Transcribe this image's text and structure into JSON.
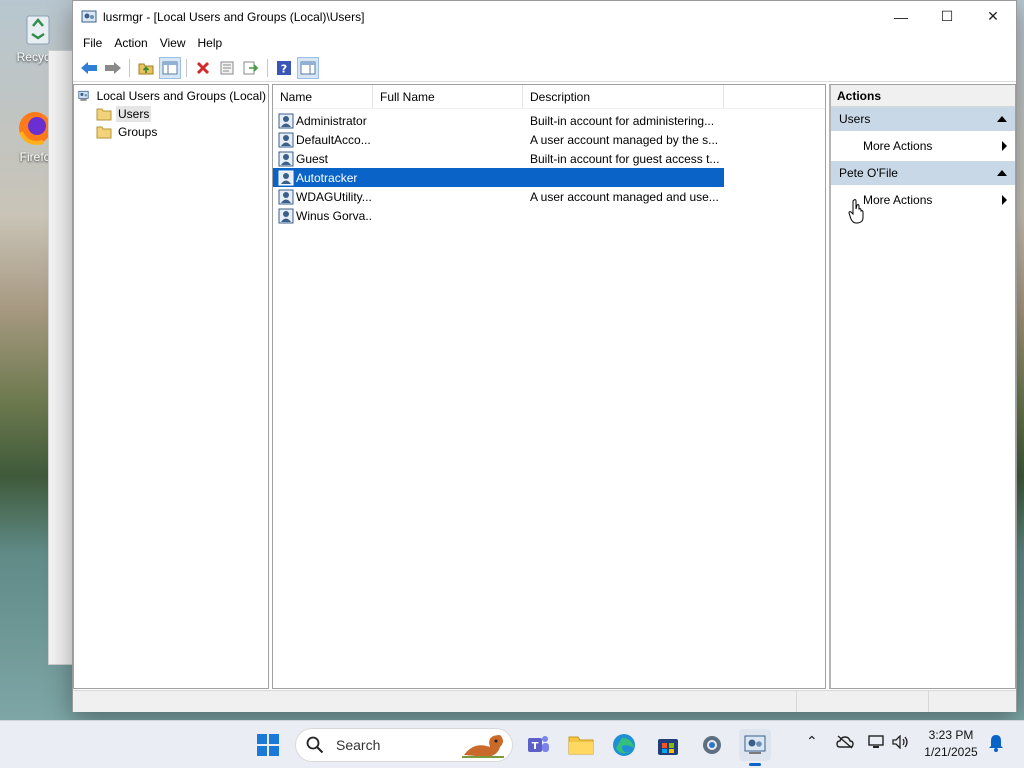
{
  "desktop": {
    "icons": [
      {
        "label": "Recycle",
        "icon": "recycle-bin-icon"
      },
      {
        "label": "Firefo",
        "icon": "firefox-icon"
      }
    ]
  },
  "window": {
    "title": "lusrmgr - [Local Users and Groups (Local)\\Users]",
    "controls": {
      "minimize": "—",
      "maximize": "☐",
      "close": "✕"
    }
  },
  "menu": [
    "File",
    "Action",
    "View",
    "Help"
  ],
  "toolbar": [
    "back-icon",
    "forward-icon",
    "up-folder-icon",
    "show-hide-tree-icon",
    "delete-icon",
    "properties-icon",
    "export-list-icon",
    "help-icon",
    "show-hide-action-pane-icon"
  ],
  "tree": {
    "root": "Local Users and Groups (Local)",
    "children": [
      {
        "label": "Users",
        "selected": true
      },
      {
        "label": "Groups",
        "selected": false
      }
    ]
  },
  "list": {
    "columns": [
      "Name",
      "Full Name",
      "Description"
    ],
    "rows": [
      {
        "name": "Administrator",
        "full_name": "",
        "description": "Built-in account for administering...",
        "selected": false
      },
      {
        "name": "DefaultAcco...",
        "full_name": "",
        "description": "A user account managed by the s...",
        "selected": false
      },
      {
        "name": "Guest",
        "full_name": "",
        "description": "Built-in account for guest access t...",
        "selected": false
      },
      {
        "name": "Autotracker",
        "full_name": "",
        "description": "",
        "selected": true
      },
      {
        "name": "WDAGUtility...",
        "full_name": "",
        "description": "A user account managed and use...",
        "selected": false
      },
      {
        "name": "Winus Gorva...",
        "full_name": "",
        "description": "",
        "selected": false
      }
    ]
  },
  "actions": {
    "header": "Actions",
    "sections": [
      {
        "title": "Users",
        "item": "More Actions"
      },
      {
        "title": "Pete O'File",
        "item": "More Actions"
      }
    ]
  },
  "taskbar": {
    "search_placeholder": "Search",
    "clock_time": "3:23 PM",
    "clock_date": "1/21/2025",
    "colors": {
      "accent": "#0a64c8",
      "taskbar": "#eaeef4"
    }
  }
}
